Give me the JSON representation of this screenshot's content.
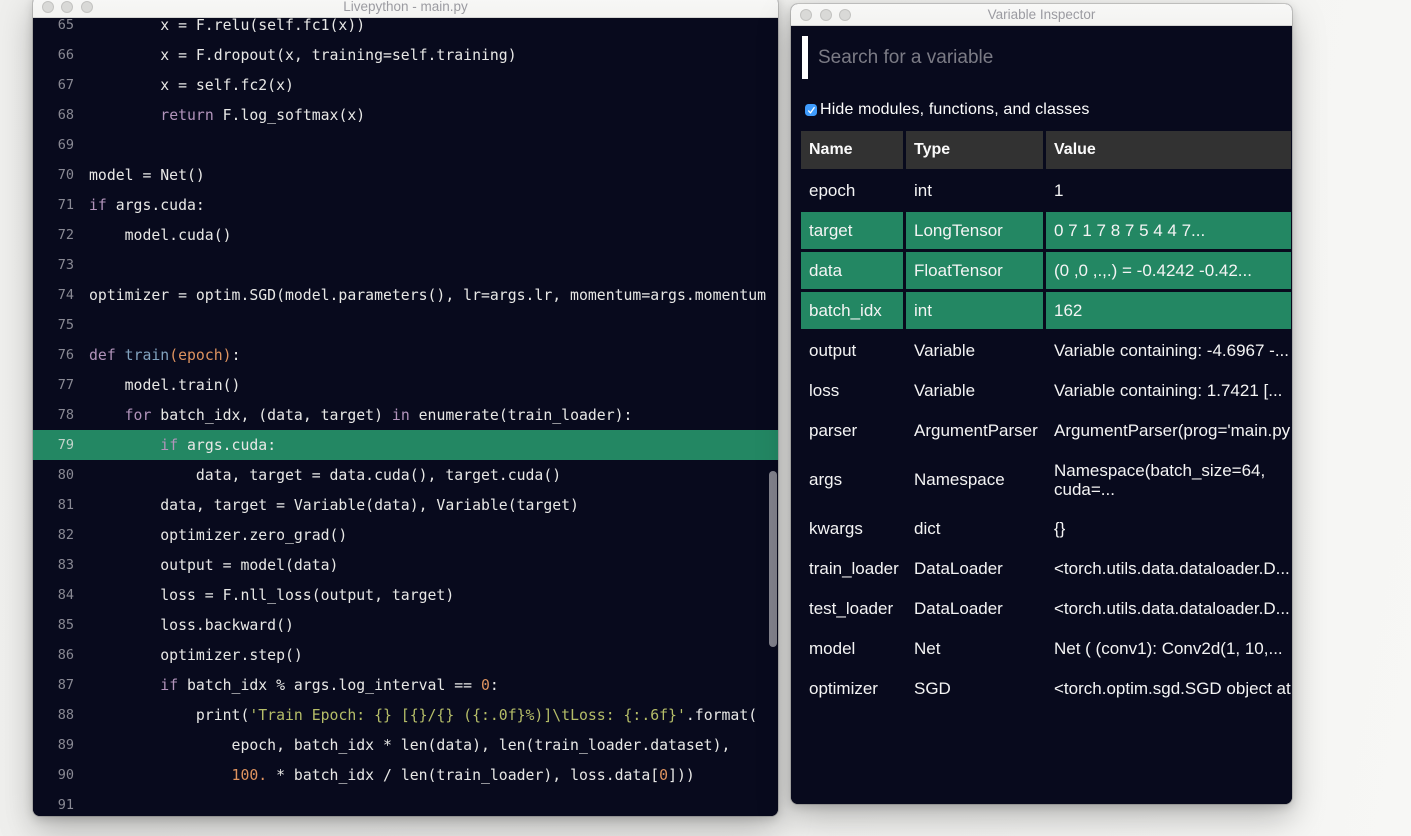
{
  "background_color": "#f1f1ef",
  "colors": {
    "window_bg": "#080a1d",
    "highlight_green": "#238763",
    "table_header_bg": "#323232",
    "checkbox_blue": "#3f9cfd",
    "keyword": "#b294bb",
    "function_name": "#81a2be",
    "number_param": "#de935f",
    "string": "#b5bd68",
    "code_text": "#e8e8e6",
    "gutter_text": "#8a8a94"
  },
  "editor_window": {
    "title": "Livepython - main.py",
    "lines": [
      {
        "n": "65",
        "seg": [
          [
            "p",
            "        x = F.relu(self.fc1(x))"
          ]
        ]
      },
      {
        "n": "66",
        "seg": [
          [
            "p",
            "        x = F.dropout(x, training=self.training)"
          ]
        ]
      },
      {
        "n": "67",
        "seg": [
          [
            "p",
            "        x = self.fc2(x)"
          ]
        ]
      },
      {
        "n": "68",
        "seg": [
          [
            "p",
            "        "
          ],
          [
            "k",
            "return"
          ],
          [
            "p",
            " F.log_softmax(x)"
          ]
        ]
      },
      {
        "n": "69",
        "seg": []
      },
      {
        "n": "70",
        "seg": [
          [
            "p",
            "model = Net()"
          ]
        ]
      },
      {
        "n": "71",
        "seg": [
          [
            "k",
            "if"
          ],
          [
            "p",
            " args.cuda:"
          ]
        ]
      },
      {
        "n": "72",
        "seg": [
          [
            "p",
            "    model.cuda()"
          ]
        ]
      },
      {
        "n": "73",
        "seg": []
      },
      {
        "n": "74",
        "seg": [
          [
            "p",
            "optimizer = optim.SGD(model.parameters(), lr=args.lr, momentum=args.momentum"
          ]
        ]
      },
      {
        "n": "75",
        "seg": []
      },
      {
        "n": "76",
        "seg": [
          [
            "k",
            "def"
          ],
          [
            "p",
            " "
          ],
          [
            "f",
            "train"
          ],
          [
            "o",
            "(epoch)"
          ],
          [
            "p",
            ":"
          ]
        ]
      },
      {
        "n": "77",
        "seg": [
          [
            "p",
            "    model.train()"
          ]
        ]
      },
      {
        "n": "78",
        "seg": [
          [
            "p",
            "    "
          ],
          [
            "k",
            "for"
          ],
          [
            "p",
            " batch_idx, (data, target) "
          ],
          [
            "k",
            "in"
          ],
          [
            "p",
            " enumerate(train_loader):"
          ]
        ]
      },
      {
        "n": "79",
        "highlight": true,
        "seg": [
          [
            "p",
            "        "
          ],
          [
            "k",
            "if"
          ],
          [
            "p",
            " args.cuda:"
          ]
        ]
      },
      {
        "n": "80",
        "seg": [
          [
            "p",
            "            data, target = data.cuda(), target.cuda()"
          ]
        ]
      },
      {
        "n": "81",
        "seg": [
          [
            "p",
            "        data, target = Variable(data), Variable(target)"
          ]
        ]
      },
      {
        "n": "82",
        "seg": [
          [
            "p",
            "        optimizer.zero_grad()"
          ]
        ]
      },
      {
        "n": "83",
        "seg": [
          [
            "p",
            "        output = model(data)"
          ]
        ]
      },
      {
        "n": "84",
        "seg": [
          [
            "p",
            "        loss = F.nll_loss(output, target)"
          ]
        ]
      },
      {
        "n": "85",
        "seg": [
          [
            "p",
            "        loss.backward()"
          ]
        ]
      },
      {
        "n": "86",
        "seg": [
          [
            "p",
            "        optimizer.step()"
          ]
        ]
      },
      {
        "n": "87",
        "seg": [
          [
            "p",
            "        "
          ],
          [
            "k",
            "if"
          ],
          [
            "p",
            " batch_idx % args.log_interval == "
          ],
          [
            "o",
            "0"
          ],
          [
            "p",
            ":"
          ]
        ]
      },
      {
        "n": "88",
        "seg": [
          [
            "p",
            "            print("
          ],
          [
            "s",
            "'Train Epoch: {} [{}/{} ({:.0f}%)]\\tLoss: {:.6f}'"
          ],
          [
            "p",
            ".format("
          ]
        ]
      },
      {
        "n": "89",
        "seg": [
          [
            "p",
            "                epoch, batch_idx * len(data), len(train_loader.dataset),"
          ]
        ]
      },
      {
        "n": "90",
        "seg": [
          [
            "p",
            "                "
          ],
          [
            "o",
            "100."
          ],
          [
            "p",
            " * batch_idx / len(train_loader), loss.data["
          ],
          [
            "o",
            "0"
          ],
          [
            "p",
            "]))"
          ]
        ]
      },
      {
        "n": "91",
        "seg": []
      }
    ]
  },
  "inspector_window": {
    "title": "Variable Inspector",
    "search_placeholder": "Search for a variable",
    "checkbox_label": "Hide modules, functions, and classes",
    "checkbox_checked": true,
    "table": {
      "columns": [
        "Name",
        "Type",
        "Value"
      ],
      "rows": [
        {
          "name": "epoch",
          "type": "int",
          "value": "1",
          "highlight": false
        },
        {
          "name": "target",
          "type": "LongTensor",
          "value": "0 7 1 7 8 7 5 4 4 7...",
          "highlight": true
        },
        {
          "name": "data",
          "type": "FloatTensor",
          "value": "(0 ,0 ,.,.) = -0.4242 -0.42...",
          "highlight": true
        },
        {
          "name": "batch_idx",
          "type": "int",
          "value": "162",
          "highlight": true
        },
        {
          "name": "output",
          "type": "Variable",
          "value": "Variable containing: -4.6967 -...",
          "highlight": false
        },
        {
          "name": "loss",
          "type": "Variable",
          "value": "Variable containing: 1.7421 [...",
          "highlight": false
        },
        {
          "name": "parser",
          "type": "ArgumentParser",
          "value": "ArgumentParser(prog='main.py',...",
          "highlight": false
        },
        {
          "name": "args",
          "type": "Namespace",
          "value": "Namespace(batch_size=64, cuda=...",
          "highlight": false,
          "wrap": true
        },
        {
          "name": "kwargs",
          "type": "dict",
          "value": "{}",
          "highlight": false
        },
        {
          "name": "train_loader",
          "type": "DataLoader",
          "value": "<torch.utils.data.dataloader.D...",
          "highlight": false
        },
        {
          "name": "test_loader",
          "type": "DataLoader",
          "value": "<torch.utils.data.dataloader.D...",
          "highlight": false
        },
        {
          "name": "model",
          "type": "Net",
          "value": "Net ( (conv1): Conv2d(1, 10,...",
          "highlight": false
        },
        {
          "name": "optimizer",
          "type": "SGD",
          "value": "<torch.optim.sgd.SGD object at...",
          "highlight": false
        }
      ]
    }
  }
}
